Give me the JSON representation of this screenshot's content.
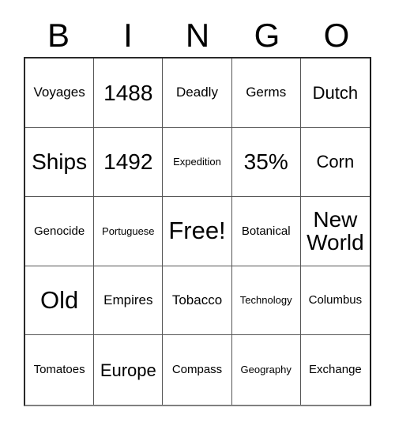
{
  "card": {
    "header_letters": [
      "B",
      "I",
      "N",
      "G",
      "O"
    ],
    "columns": [
      {
        "letter": "B",
        "cells": [
          {
            "text": "Voyages",
            "size": "sm"
          },
          {
            "text": "Ships",
            "size": "lg"
          },
          {
            "text": "Genocide",
            "size": "xs"
          },
          {
            "text": "Old",
            "size": "xl"
          },
          {
            "text": "Tomatoes",
            "size": "xs"
          }
        ]
      },
      {
        "letter": "I",
        "cells": [
          {
            "text": "1488",
            "size": "lg"
          },
          {
            "text": "1492",
            "size": "lg"
          },
          {
            "text": "Portuguese",
            "size": "xxs"
          },
          {
            "text": "Empires",
            "size": "sm"
          },
          {
            "text": "Europe",
            "size": "md"
          }
        ]
      },
      {
        "letter": "N",
        "cells": [
          {
            "text": "Deadly",
            "size": "sm"
          },
          {
            "text": "Expedition",
            "size": "xxs"
          },
          {
            "text": "Free!",
            "size": "xl"
          },
          {
            "text": "Tobacco",
            "size": "sm"
          },
          {
            "text": "Compass",
            "size": "xs"
          }
        ]
      },
      {
        "letter": "G",
        "cells": [
          {
            "text": "Germs",
            "size": "sm"
          },
          {
            "text": "35%",
            "size": "lg"
          },
          {
            "text": "Botanical",
            "size": "xs"
          },
          {
            "text": "Technology",
            "size": "xxs"
          },
          {
            "text": "Geography",
            "size": "xxs"
          }
        ]
      },
      {
        "letter": "O",
        "cells": [
          {
            "text": "Dutch",
            "size": "md"
          },
          {
            "text": "Corn",
            "size": "md"
          },
          {
            "text": "New World",
            "size": "lg"
          },
          {
            "text": "Columbus",
            "size": "xs"
          },
          {
            "text": "Exchange",
            "size": "xs"
          }
        ]
      }
    ],
    "rows": [
      [
        "Voyages",
        "1488",
        "Deadly",
        "Germs",
        "Dutch"
      ],
      [
        "Ships",
        "1492",
        "Expedition",
        "35%",
        "Corn"
      ],
      [
        "Genocide",
        "Portuguese",
        "Free!",
        "Botanical",
        "New World"
      ],
      [
        "Old",
        "Empires",
        "Tobacco",
        "Technology",
        "Columbus"
      ],
      [
        "Tomatoes",
        "Europe",
        "Compass",
        "Geography",
        "Exchange"
      ]
    ],
    "free_space": "Free!",
    "colors": {
      "background": "#ffffff",
      "text": "#000000",
      "grid_line": "#555555",
      "outer_border": "#2a2a2a"
    }
  }
}
